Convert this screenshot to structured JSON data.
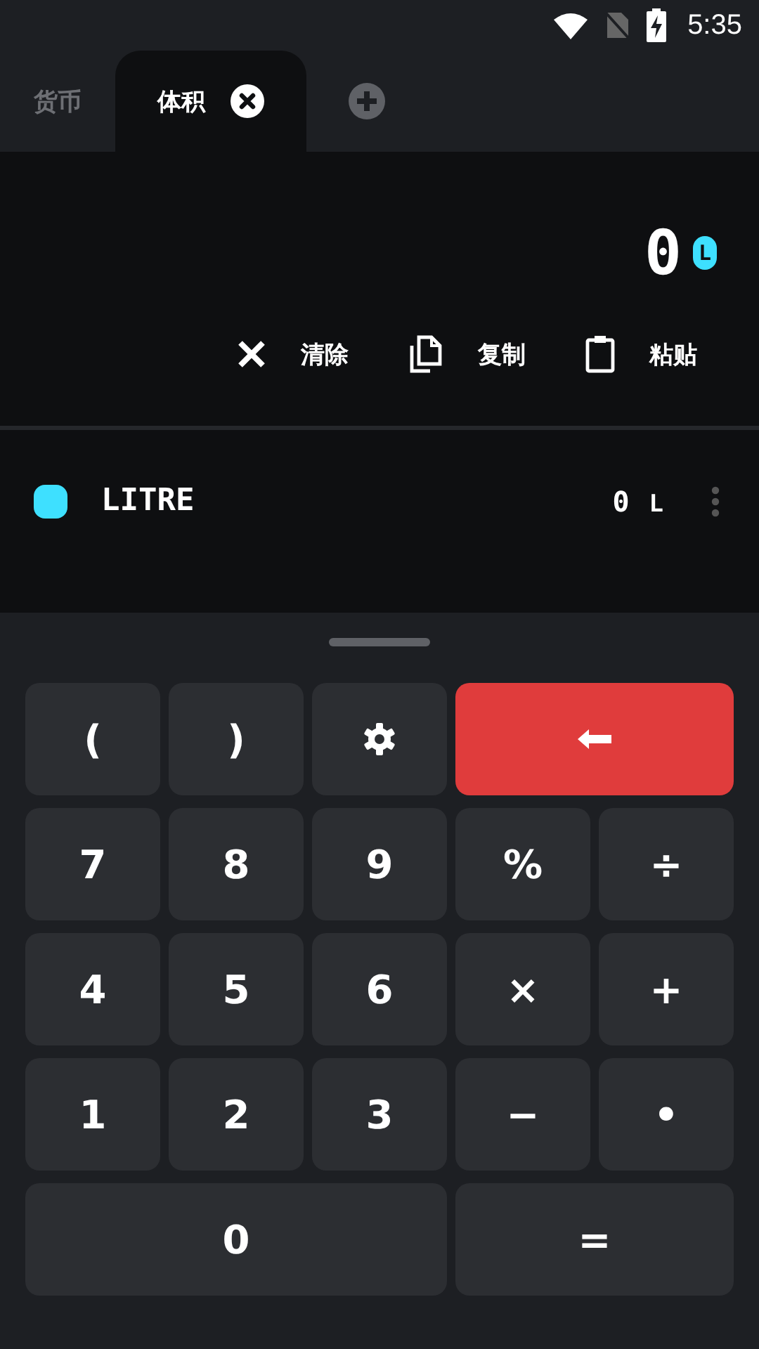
{
  "status_bar": {
    "time": "5:35"
  },
  "tabs": [
    {
      "label": "货币",
      "selected": false
    },
    {
      "label": "体积",
      "selected": true
    }
  ],
  "display": {
    "value": "0",
    "unit": "L"
  },
  "actions": [
    {
      "kind": "clear",
      "label": "清除"
    },
    {
      "kind": "copy",
      "label": "复制"
    },
    {
      "kind": "paste",
      "label": "粘贴"
    }
  ],
  "units": [
    {
      "name": "LITRE",
      "value": "0",
      "unit": "L",
      "color": "#3ee0ff"
    }
  ],
  "keypad": [
    {
      "kind": "key",
      "label": "("
    },
    {
      "kind": "key",
      "label": ")"
    },
    {
      "kind": "settings"
    },
    {
      "kind": "backspace"
    },
    {
      "kind": "key",
      "label": "7"
    },
    {
      "kind": "key",
      "label": "8"
    },
    {
      "kind": "key",
      "label": "9"
    },
    {
      "kind": "key",
      "label": "%"
    },
    {
      "kind": "key",
      "label": "÷"
    },
    {
      "kind": "key",
      "label": "4"
    },
    {
      "kind": "key",
      "label": "5"
    },
    {
      "kind": "key",
      "label": "6"
    },
    {
      "kind": "key",
      "label": "×"
    },
    {
      "kind": "key",
      "label": "+"
    },
    {
      "kind": "key",
      "label": "1"
    },
    {
      "kind": "key",
      "label": "2"
    },
    {
      "kind": "key",
      "label": "3"
    },
    {
      "kind": "key",
      "label": "−"
    },
    {
      "kind": "key",
      "label": "•"
    },
    {
      "kind": "triple",
      "label": "0"
    },
    {
      "kind": "wide",
      "label": "="
    }
  ]
}
